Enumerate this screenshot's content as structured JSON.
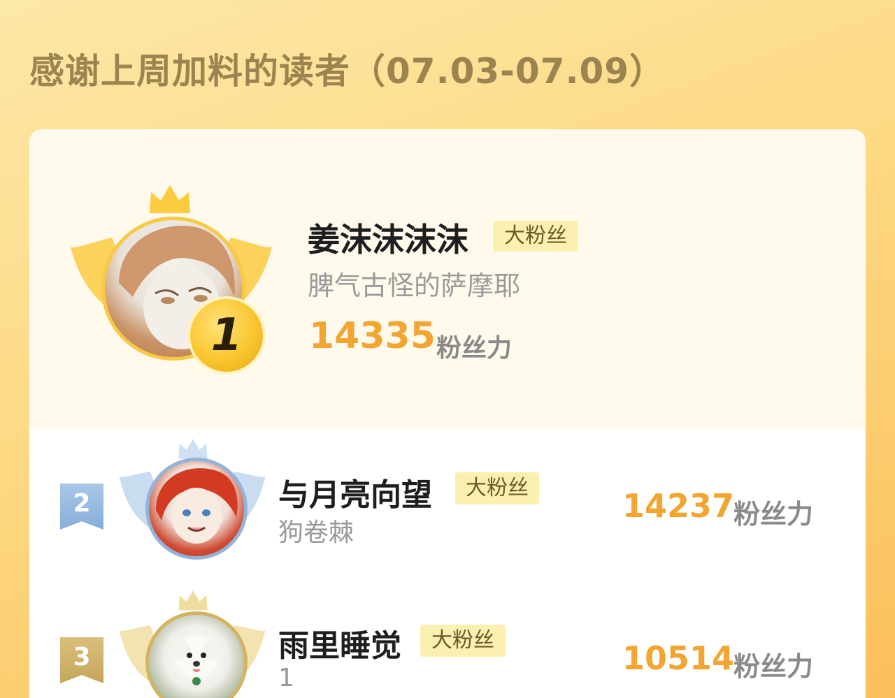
{
  "header": {
    "title": "感谢上周加料的读者（07.03-07.09）"
  },
  "colors": {
    "accent": "#f2a531",
    "badge_bg": "#fcf0b0",
    "gold": "#fac62f",
    "silver": "#9cc0e4",
    "bronze": "#cfb26a"
  },
  "ranking": [
    {
      "rank": "1",
      "name": "姜沫沫沫沫",
      "badge": "大粉丝",
      "subtitle": "脾气古怪的萨摩耶",
      "score": "14335",
      "unit": "粉丝力"
    },
    {
      "rank": "2",
      "name": "与月亮向望",
      "badge": "大粉丝",
      "subtitle": "狗卷棘",
      "score": "14237",
      "unit": "粉丝力"
    },
    {
      "rank": "3",
      "name": "雨里睡觉",
      "badge": "大粉丝",
      "subtitle": "1",
      "score": "10514",
      "unit": "粉丝力"
    }
  ]
}
